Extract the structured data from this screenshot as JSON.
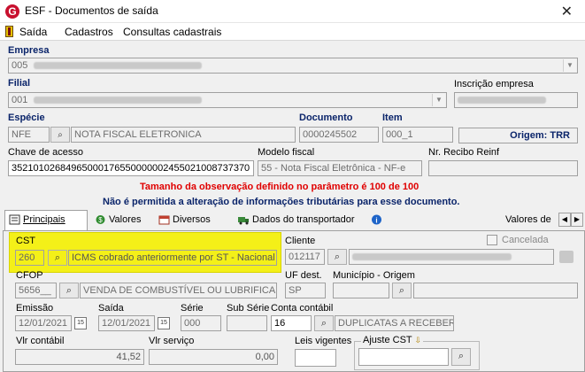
{
  "window": {
    "title": "ESF - Documentos de saída",
    "close_glyph": "✕",
    "app_icon_letter": "G"
  },
  "menu": [
    "Saída",
    "Cadastros",
    "Consultas cadastrais"
  ],
  "empresa": {
    "label": "Empresa",
    "value": "005"
  },
  "filial": {
    "label": "Filial",
    "value": "001"
  },
  "inscricao": {
    "label": "Inscrição empresa"
  },
  "especie": {
    "label": "Espécie",
    "code": "NFE",
    "desc": "NOTA FISCAL ELETRONICA"
  },
  "documento": {
    "label": "Documento",
    "value": "0000245502"
  },
  "item": {
    "label": "Item",
    "value": "000_1"
  },
  "origem": "Origem: TRR",
  "chave": {
    "label": "Chave de acesso",
    "value": "35210102684965000176550000002455021008737370"
  },
  "modelo": {
    "label": "Modelo fiscal",
    "value": "55 - Nota Fiscal Eletrônica - NF-e"
  },
  "recibo": {
    "label": "Nr. Recibo Reinf",
    "value": ""
  },
  "warnings": {
    "red": "Tamanho da observação definido no parâmetro é 100 de 100",
    "navy": "Não é permitida a alteração de informações tributárias para esse documento."
  },
  "tabs": [
    {
      "label": "Principais",
      "icon": "document-icon"
    },
    {
      "label": "Valores",
      "icon": "money-icon"
    },
    {
      "label": "Diversos",
      "icon": "calendar-icon"
    },
    {
      "label": "Dados do transportador",
      "icon": "truck-icon"
    },
    {
      "label": "",
      "icon": "info-icon"
    },
    {
      "label": "Valores de",
      "icon": ""
    }
  ],
  "cst": {
    "label": "CST",
    "code": "260",
    "desc": "ICMS cobrado anteriormente por ST - Nacional"
  },
  "cliente": {
    "label": "Cliente",
    "code": "012117"
  },
  "cancelada": {
    "label": "Cancelada",
    "checked": false
  },
  "cfop": {
    "label": "CFOP",
    "code": "5656__",
    "desc": "VENDA DE COMBUSTÍVEL OU LUBRIFICAN"
  },
  "uf_dest": {
    "label": "UF dest.",
    "value": "SP"
  },
  "municipio": {
    "label": "Município - Origem",
    "value": ""
  },
  "emissao": {
    "label": "Emissão",
    "value": "12/01/2021"
  },
  "saida": {
    "label": "Saída",
    "value": "12/01/2021"
  },
  "serie": {
    "label": "Série",
    "value": "000"
  },
  "sub_serie": {
    "label": "Sub Série",
    "value": ""
  },
  "conta": {
    "label": "Conta contábil",
    "code": "16",
    "desc": "DUPLICATAS A RECEBER"
  },
  "vlr_contabil": {
    "label": "Vlr contábil",
    "value": "41,52"
  },
  "vlr_servico": {
    "label": "Vlr serviço",
    "value": "0,00"
  },
  "leis": {
    "label": "Leis vigentes",
    "value": ""
  },
  "ajuste": {
    "label": "Ajuste CST",
    "value": ""
  },
  "calendar_glyph": "15",
  "binoculars_glyph": "🔭"
}
